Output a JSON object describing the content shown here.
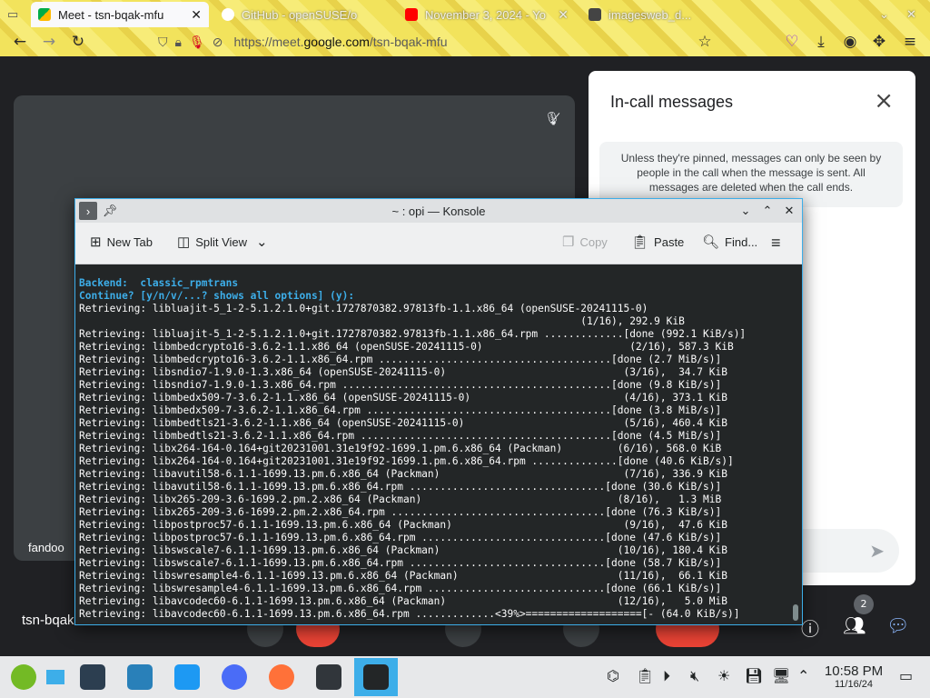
{
  "browser": {
    "tabs": [
      {
        "title": "Meet - tsn-bqak-mfu",
        "active": true
      },
      {
        "title": "GitHub - openSUSE/o",
        "active": false
      },
      {
        "title": "November 3, 2024 - Yo",
        "active": false
      },
      {
        "title": "imagesweb_d...",
        "active": false
      }
    ],
    "url_prefix": "https://meet.",
    "url_domain": "google.com",
    "url_path": "/tsn-bqak-mfu",
    "colors": {
      "bg": "#f2e35c",
      "accent": "#3daee9"
    }
  },
  "meet": {
    "participant_name": "fandoo",
    "meeting_code": "tsn-bqak-mfu",
    "panel_title": "In-call messages",
    "notice": "Unless they're pinned, messages can only be seen by people in the call when the message is sent. All messages are deleted when the call ends.",
    "people_count": "2"
  },
  "konsole": {
    "title": "~ : opi — Konsole",
    "toolbar": {
      "new_tab": "New Tab",
      "split_view": "Split View",
      "copy": "Copy",
      "paste": "Paste",
      "find": "Find..."
    },
    "lines": [
      {
        "text": "Backend:  classic_rpmtrans",
        "hl": true
      },
      {
        "text": "Continue? [y/n/v/...? shows all options] (y):",
        "hl": true
      },
      {
        "text": "Retrieving: libluajit-5_1-2-5.1.2.1.0+git.1727870382.97813fb-1.1.x86_64 (openSUSE-20241115-0)",
        "hl": false
      },
      {
        "text": "                                                                                  (1/16), 292.9 KiB",
        "hl": false
      },
      {
        "text": "Retrieving: libluajit-5_1-2-5.1.2.1.0+git.1727870382.97813fb-1.1.x86_64.rpm .............[done (992.1 KiB/s)]",
        "hl": false
      },
      {
        "text": "Retrieving: libmbedcrypto16-3.6.2-1.1.x86_64 (openSUSE-20241115-0)                        (2/16), 587.3 KiB",
        "hl": false
      },
      {
        "text": "Retrieving: libmbedcrypto16-3.6.2-1.1.x86_64.rpm ......................................[done (2.7 MiB/s)]",
        "hl": false
      },
      {
        "text": "Retrieving: libsndio7-1.9.0-1.3.x86_64 (openSUSE-20241115-0)                             (3/16),  34.7 KiB",
        "hl": false
      },
      {
        "text": "Retrieving: libsndio7-1.9.0-1.3.x86_64.rpm ............................................[done (9.8 KiB/s)]",
        "hl": false
      },
      {
        "text": "Retrieving: libmbedx509-7-3.6.2-1.1.x86_64 (openSUSE-20241115-0)                         (4/16), 373.1 KiB",
        "hl": false
      },
      {
        "text": "Retrieving: libmbedx509-7-3.6.2-1.1.x86_64.rpm ........................................[done (3.8 MiB/s)]",
        "hl": false
      },
      {
        "text": "Retrieving: libmbedtls21-3.6.2-1.1.x86_64 (openSUSE-20241115-0)                          (5/16), 460.4 KiB",
        "hl": false
      },
      {
        "text": "Retrieving: libmbedtls21-3.6.2-1.1.x86_64.rpm .........................................[done (4.5 MiB/s)]",
        "hl": false
      },
      {
        "text": "Retrieving: libx264-164-0.164+git20231001.31e19f92-1699.1.pm.6.x86_64 (Packman)         (6/16), 568.0 KiB",
        "hl": false
      },
      {
        "text": "Retrieving: libx264-164-0.164+git20231001.31e19f92-1699.1.pm.6.x86_64.rpm ..............[done (40.6 KiB/s)]",
        "hl": false
      },
      {
        "text": "Retrieving: libavutil58-6.1.1-1699.13.pm.6.x86_64 (Packman)                              (7/16), 336.9 KiB",
        "hl": false
      },
      {
        "text": "Retrieving: libavutil58-6.1.1-1699.13.pm.6.x86_64.rpm ................................[done (30.6 KiB/s)]",
        "hl": false
      },
      {
        "text": "Retrieving: libx265-209-3.6-1699.2.pm.2.x86_64 (Packman)                                (8/16),   1.3 MiB",
        "hl": false
      },
      {
        "text": "Retrieving: libx265-209-3.6-1699.2.pm.2.x86_64.rpm ...................................[done (76.3 KiB/s)]",
        "hl": false
      },
      {
        "text": "Retrieving: libpostproc57-6.1.1-1699.13.pm.6.x86_64 (Packman)                            (9/16),  47.6 KiB",
        "hl": false
      },
      {
        "text": "Retrieving: libpostproc57-6.1.1-1699.13.pm.6.x86_64.rpm ..............................[done (47.6 KiB/s)]",
        "hl": false
      },
      {
        "text": "Retrieving: libswscale7-6.1.1-1699.13.pm.6.x86_64 (Packman)                             (10/16), 180.4 KiB",
        "hl": false
      },
      {
        "text": "Retrieving: libswscale7-6.1.1-1699.13.pm.6.x86_64.rpm ................................[done (58.7 KiB/s)]",
        "hl": false
      },
      {
        "text": "Retrieving: libswresample4-6.1.1-1699.13.pm.6.x86_64 (Packman)                          (11/16),  66.1 KiB",
        "hl": false
      },
      {
        "text": "Retrieving: libswresample4-6.1.1-1699.13.pm.6.x86_64.rpm .............................[done (66.1 KiB/s)]",
        "hl": false
      },
      {
        "text": "Retrieving: libavcodec60-6.1.1-1699.13.pm.6.x86_64 (Packman)                            (12/16),   5.0 MiB",
        "hl": false
      },
      {
        "text": "Retrieving: libavcodec60-6.1.1-1699.13.pm.6.x86_64.rpm .............<39%>===================[- (64.0 KiB/s)]",
        "hl": false
      }
    ]
  },
  "taskbar": {
    "time": "10:58 PM",
    "date": "11/16/24"
  }
}
